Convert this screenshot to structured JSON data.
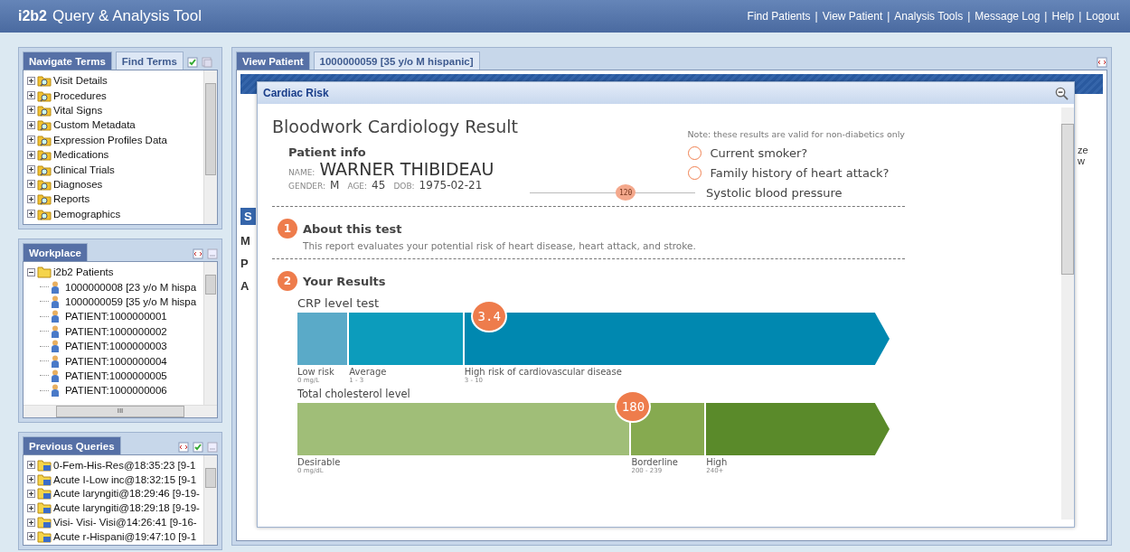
{
  "app": {
    "logo": "i2b2",
    "title": "Query & Analysis Tool",
    "link_separator": "|",
    "links": [
      "Find Patients",
      "View Patient",
      "Analysis Tools",
      "Message Log",
      "Help",
      "Logout"
    ]
  },
  "navigate_panel": {
    "tabs": [
      {
        "label": "Navigate Terms",
        "selected": true
      },
      {
        "label": "Find Terms",
        "selected": false
      }
    ],
    "items": [
      {
        "name": "Visit Details",
        "expanded": false
      },
      {
        "name": "Procedures",
        "expanded": false
      },
      {
        "name": "Vital Signs",
        "expanded": false
      },
      {
        "name": "Custom Metadata",
        "expanded": false
      },
      {
        "name": "Expression Profiles Data",
        "expanded": false
      },
      {
        "name": "Medications",
        "expanded": false
      },
      {
        "name": "Clinical Trials",
        "expanded": false
      },
      {
        "name": "Diagnoses",
        "expanded": false
      },
      {
        "name": "Reports",
        "expanded": false
      },
      {
        "name": "Demographics",
        "expanded": false
      }
    ]
  },
  "workplace_panel": {
    "tab": "Workplace",
    "tree": [
      {
        "name": "i2b2 Patients",
        "expanded": true,
        "children": [
          {
            "name": "1000000008 [23 y/o M hispa"
          },
          {
            "name": "1000000059 [35 y/o M hispa"
          },
          {
            "name": "PATIENT:1000000001"
          },
          {
            "name": "PATIENT:1000000002"
          },
          {
            "name": "PATIENT:1000000003"
          },
          {
            "name": "PATIENT:1000000004"
          },
          {
            "name": "PATIENT:1000000005"
          },
          {
            "name": "PATIENT:1000000006"
          }
        ]
      }
    ],
    "scroll_thumb": "III"
  },
  "queries_panel": {
    "tab": "Previous Queries",
    "items": [
      {
        "name": "0-Fem-His-Res@18:35:23 [9-1",
        "expanded": false
      },
      {
        "name": "Acute I-Low inc@18:32:15 [9-1",
        "expanded": false
      },
      {
        "name": "Acute laryngiti@18:29:46 [9-19-",
        "expanded": false
      },
      {
        "name": "Acute laryngiti@18:29:18 [9-19-",
        "expanded": false
      },
      {
        "name": "Visi- Visi- Visi@14:26:41 [9-16-",
        "expanded": false
      },
      {
        "name": "Acute r-Hispani@19:47:10 [9-1",
        "expanded": false
      }
    ]
  },
  "main_panel": {
    "tabs": [
      {
        "label": "View Patient",
        "selected": true
      },
      {
        "label": "1000000059 [35 y/o M hispanic]",
        "selected": false
      }
    ],
    "side_letters": [
      "S",
      "M",
      "P",
      "A"
    ],
    "right_fragments": [
      "ze",
      "w"
    ]
  },
  "modal": {
    "title": "Cardiac Risk",
    "heading": "Bloodwork Cardiology Result",
    "note": "Note: these results are valid for non-diabetics only",
    "patient": {
      "section": "Patient info",
      "name_label": "NAME:",
      "name": "WARNER THIBIDEAU",
      "gender_label": "GENDER:",
      "gender": "M",
      "age_label": "AGE:",
      "age": "45",
      "dob_label": "DOB:",
      "dob": "1975-02-21"
    },
    "risk_factors": [
      {
        "label": "Current smoker?",
        "checked": false
      },
      {
        "label": "Family history of heart attack?",
        "checked": false
      }
    ],
    "blood_pressure": {
      "value": "120",
      "level": 0.58,
      "label": "Systolic blood pressure"
    },
    "sections": [
      {
        "number": "1",
        "title": "About this test",
        "text": "This report evaluates your potential risk of heart disease, heart attack, and stroke."
      },
      {
        "number": "2",
        "title": "Your Results"
      }
    ],
    "gauges": [
      {
        "title": "CRP level test",
        "value": "3.4",
        "level": 0.33,
        "segments": [
          {
            "label": "Low risk",
            "range": "0 mg/L",
            "color": "#5aaac8"
          },
          {
            "label": "Average",
            "range": "1 - 3",
            "color": "#0c9cbc"
          },
          {
            "label": "High risk of cardiovascular disease",
            "range": "3 - 10",
            "color": "#0088b0"
          }
        ]
      },
      {
        "title": "Total cholesterol level",
        "value": "180",
        "level": 0.58,
        "segments": [
          {
            "label": "Desirable",
            "range": "0 mg/dL",
            "color": "#a0be78"
          },
          {
            "label": "Borderline",
            "range": "200 - 239",
            "color": "#86aa50"
          },
          {
            "label": "High",
            "range": "240+",
            "color": "#5a8a2a"
          }
        ]
      }
    ]
  }
}
